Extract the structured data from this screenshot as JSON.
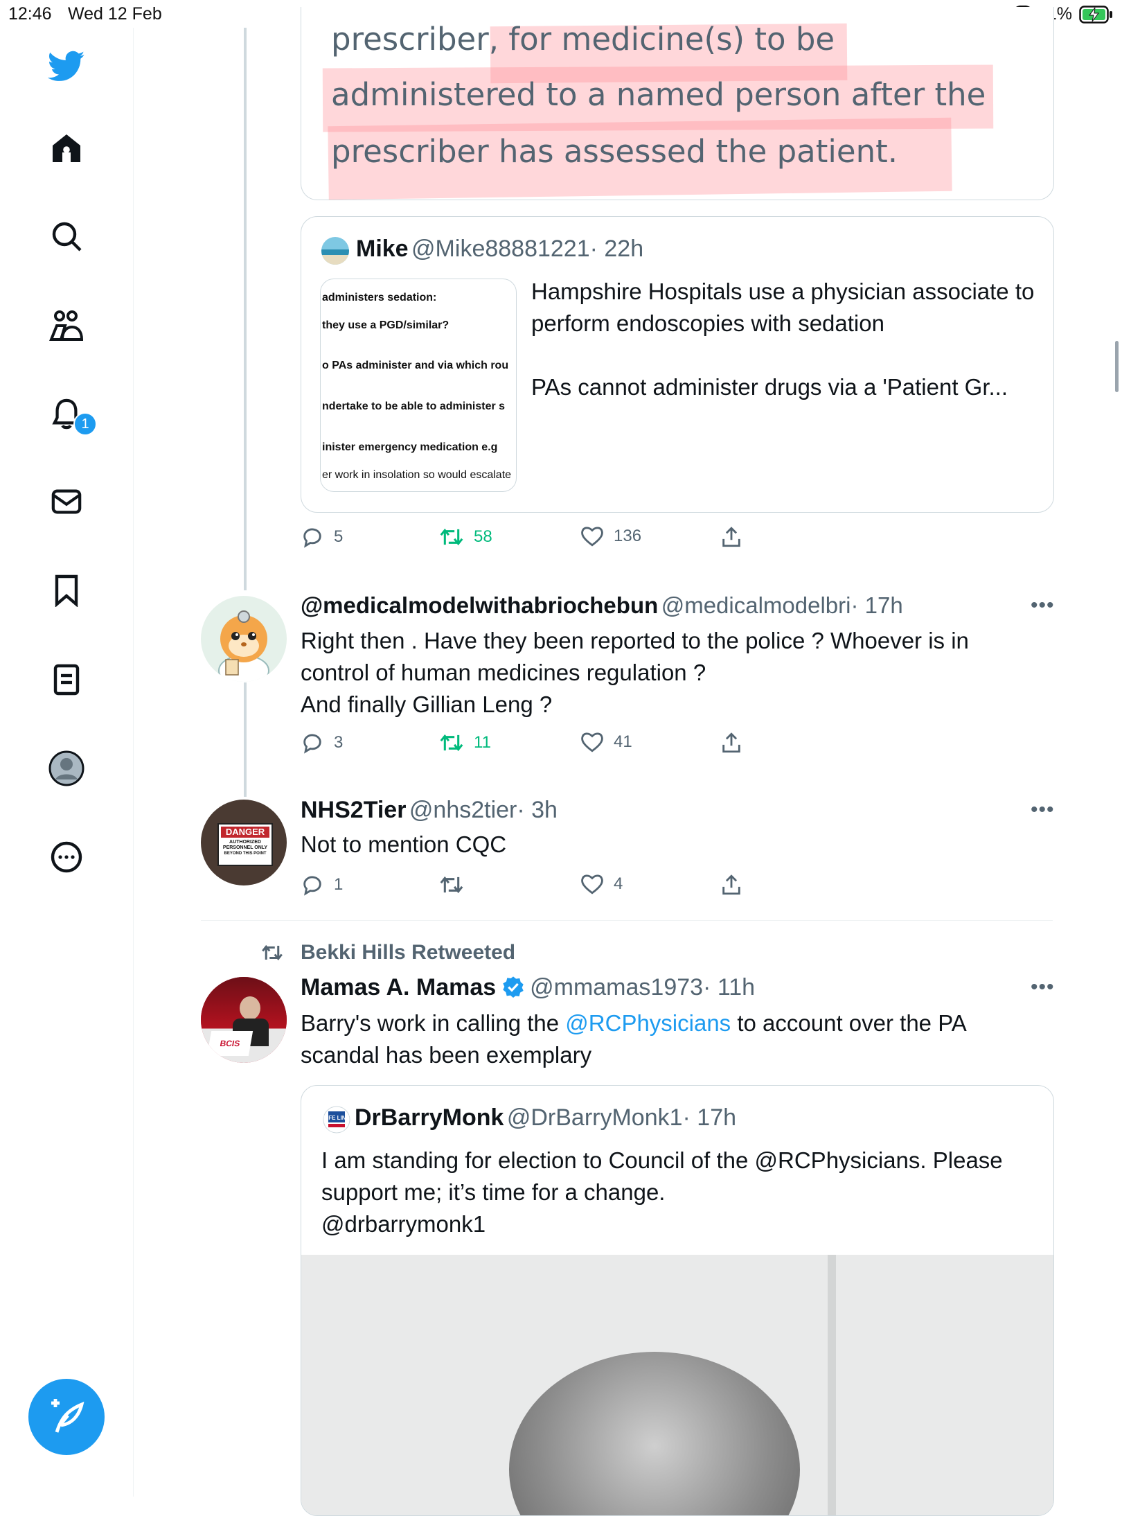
{
  "status_bar": {
    "time": "12:46",
    "date": "Wed 12 Feb",
    "battery": "91%"
  },
  "sidebar": {
    "notifications_badge": "1"
  },
  "highlight_card": {
    "lines": [
      "prescriber, for medicine(s) to be",
      "administered to a named person after the",
      "prescriber has assessed the patient."
    ]
  },
  "mike_quote": {
    "name": "Mike",
    "handle": "@Mike88881221",
    "time": "· 22h",
    "text1": "Hampshire Hospitals use a physician associate to perform endoscopies with sedation",
    "text2": "PAs cannot administer drugs via a 'Patient Gr...",
    "snippet": [
      "administers sedation:",
      "they use a PGD/similar?",
      "o PAs administer and via which rou",
      "ndertake to be able to administer s",
      "inister  emergency  medication  e.g",
      "er work in insolation so would escalate"
    ]
  },
  "tweet1_actions": {
    "replies": "5",
    "retweets": "58",
    "likes": "136"
  },
  "tweet2": {
    "name": "@medicalmodelwithabriochebun",
    "handle": "@medicalmodelbri",
    "time": "· 17h",
    "line1": "Right then . Have they been reported to the police ? Whoever is in",
    "line2": "control of human medicines regulation ?",
    "line3": "And finally Gillian Leng ?",
    "replies": "3",
    "retweets": "11",
    "likes": "41"
  },
  "tweet3": {
    "name": "NHS2Tier",
    "handle": "@nhs2tier",
    "time": "· 3h",
    "text": "Not to mention CQC",
    "replies": "1",
    "likes": "4",
    "avatar_sign": {
      "title": "DANGER",
      "lines": [
        "AUTHORIZED",
        "PERSONNEL ONLY",
        "BEYOND THIS POINT"
      ]
    }
  },
  "tweet4": {
    "retweeted_by": "Bekki Hills Retweeted",
    "name": "Mamas A. Mamas",
    "handle": "@mmamas1973",
    "time": "· 11h",
    "text_before": "Barry's work in calling the ",
    "mention": "@RCPhysicians",
    "text_after": " to account over the PA",
    "line2": "scandal has been exemplary",
    "avatar_label": "BCIS"
  },
  "barry_quote": {
    "name": "DrBarryMonk",
    "handle": "@DrBarryMonk1",
    "time": "· 17h",
    "line1": "I am standing for election to Council of the @RCPhysicians. Please",
    "line2": "support me; it’s time for a change.",
    "line3": "@drbarrymonk1",
    "avatar_label": "LIFE LINE"
  },
  "colors": {
    "accent": "#1d9bf0",
    "retweet_green": "#00ba7c",
    "muted": "#536471"
  }
}
